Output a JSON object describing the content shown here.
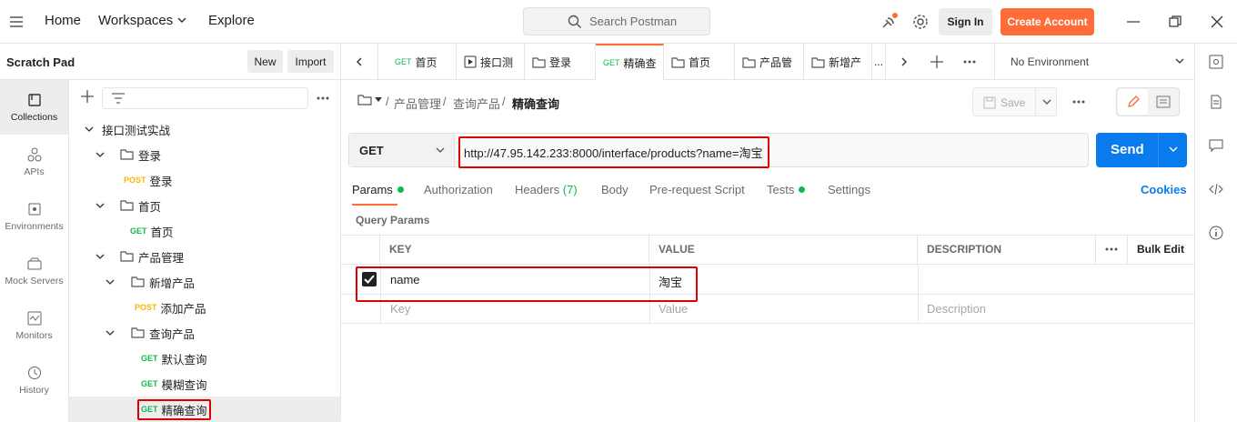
{
  "topbar": {
    "nav": [
      "Home",
      "Workspaces",
      "Explore"
    ],
    "search_placeholder": "Search Postman",
    "sign_in": "Sign In",
    "create_account": "Create Account"
  },
  "sidebar": {
    "title": "Scratch Pad",
    "new_label": "New",
    "import_label": "Import",
    "rail": [
      {
        "label": "Collections",
        "icon": "collections-icon"
      },
      {
        "label": "APIs",
        "icon": "apis-icon"
      },
      {
        "label": "Environments",
        "icon": "environments-icon"
      },
      {
        "label": "Mock Servers",
        "icon": "mock-servers-icon"
      },
      {
        "label": "Monitors",
        "icon": "monitors-icon"
      },
      {
        "label": "History",
        "icon": "history-icon"
      }
    ],
    "tree": [
      {
        "label": "接口测试实战"
      },
      {
        "label": "登录"
      },
      {
        "method": "POST",
        "label": "登录"
      },
      {
        "label": "首页"
      },
      {
        "method": "GET",
        "label": "首页"
      },
      {
        "label": "产品管理"
      },
      {
        "label": "新增产品"
      },
      {
        "method": "POST",
        "label": "添加产品"
      },
      {
        "label": "查询产品"
      },
      {
        "method": "GET",
        "label": "默认查询"
      },
      {
        "method": "GET",
        "label": "模糊查询"
      },
      {
        "method": "GET",
        "label": "精确查询"
      }
    ]
  },
  "tabs": [
    {
      "method": "GET",
      "label": "首页"
    },
    {
      "method": "",
      "label": "接口测"
    },
    {
      "method": "",
      "label": "登录"
    },
    {
      "method": "GET",
      "label": "精确查"
    },
    {
      "method": "",
      "label": "首页"
    },
    {
      "method": "",
      "label": "产品管"
    },
    {
      "method": "",
      "label": "新增产"
    },
    {
      "method": "",
      "label": "..."
    }
  ],
  "environment": "No Environment",
  "breadcrumb": {
    "sep": "/",
    "parts": [
      "产品管理",
      "查询产品",
      "精确查询"
    ]
  },
  "save_label": "Save",
  "request": {
    "method": "GET",
    "url": "http://47.95.142.233:8000/interface/products?name=淘宝",
    "send_label": "Send"
  },
  "subtabs": {
    "params": "Params",
    "authorization": "Authorization",
    "headers": "Headers",
    "headers_count": "(7)",
    "body": "Body",
    "prerequest": "Pre-request Script",
    "tests": "Tests",
    "settings": "Settings",
    "cookies": "Cookies"
  },
  "query_params_title": "Query Params",
  "table": {
    "headers": [
      "KEY",
      "VALUE",
      "DESCRIPTION"
    ],
    "bulk_edit": "Bulk Edit",
    "rows": [
      {
        "key": "name",
        "value": "淘宝",
        "description": "",
        "checked": true
      }
    ],
    "placeholders": {
      "key": "Key",
      "value": "Value",
      "description": "Description"
    }
  },
  "colors": {
    "accent": "#ff6c37",
    "send": "#097bed",
    "get": "#0cbb52",
    "post": "#ffb400",
    "highlight": "#e00000"
  }
}
